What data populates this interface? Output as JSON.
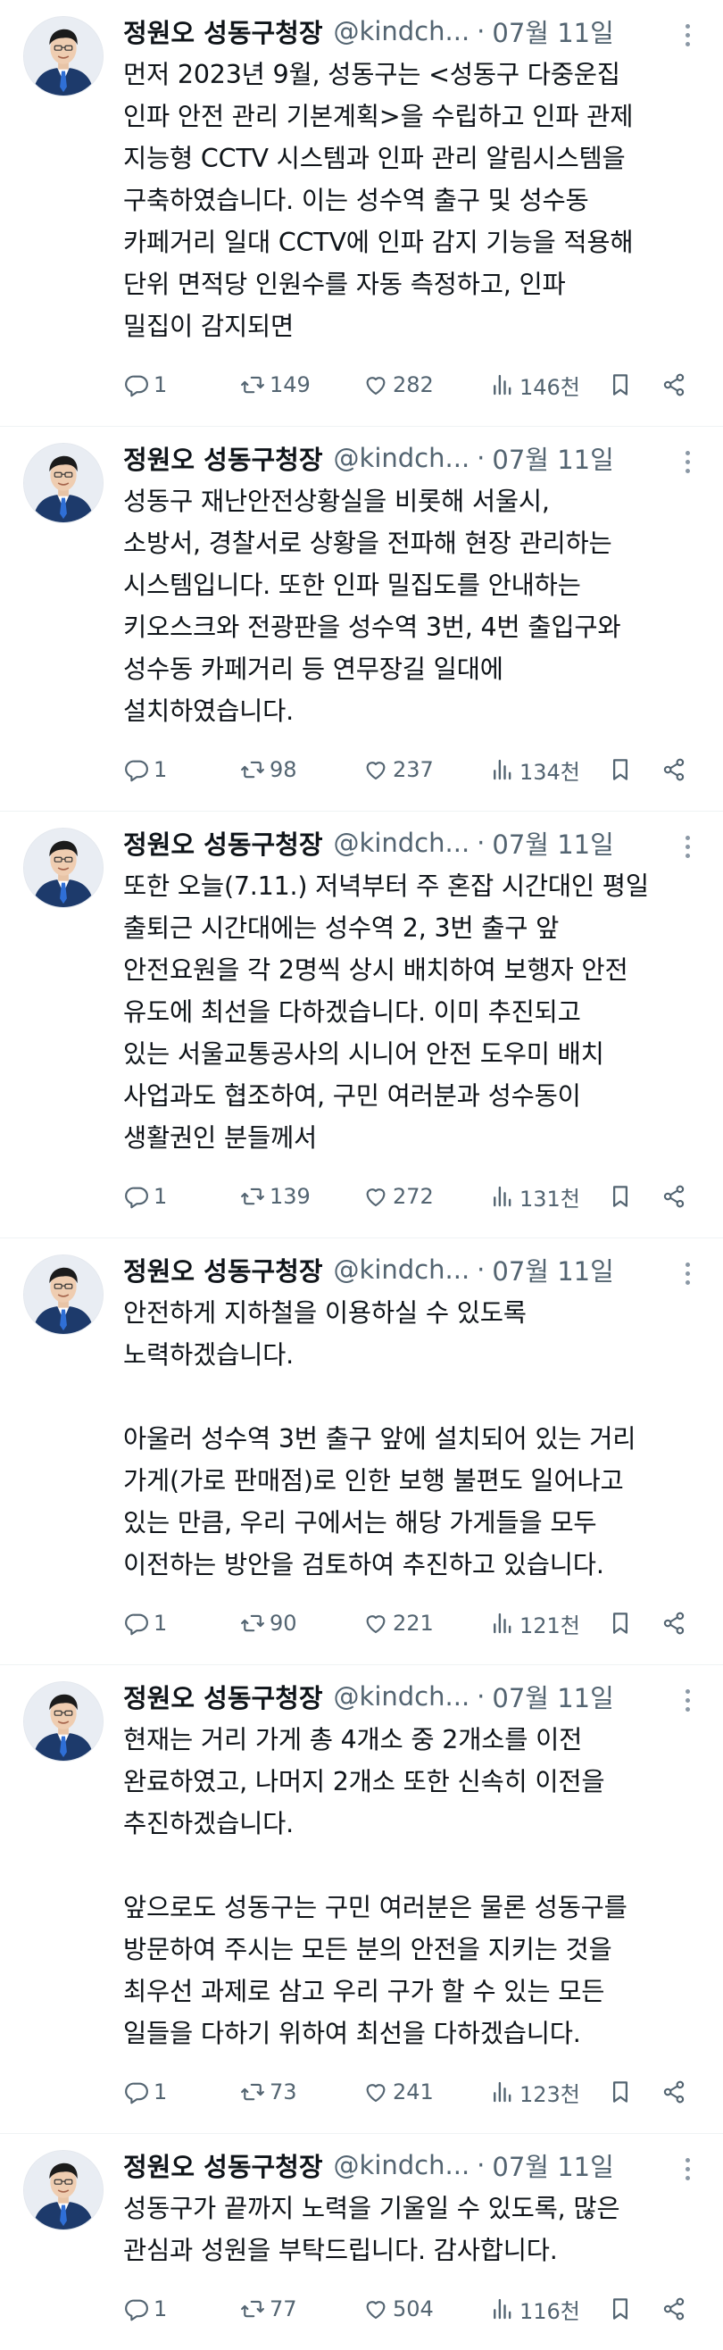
{
  "tweets": [
    {
      "name": "정원오 성동구청장",
      "handle": "@kindch...",
      "time": "07월 11일",
      "text": "먼저 2023년 9월, 성동구는 <성동구 다중운집\n인파 안전 관리 기본계획>을 수립하고 인파 관제\n지능형 CCTV 시스템과 인파 관리 알림시스템을\n구축하였습니다. 이는 성수역 출구 및 성수동\n카페거리 일대 CCTV에 인파 감지 기능을 적용해\n단위 면적당 인원수를 자동 측정하고, 인파\n밀집이 감지되면",
      "replies": "1",
      "retweets": "149",
      "likes": "282",
      "views": "146천"
    },
    {
      "name": "정원오 성동구청장",
      "handle": "@kindch...",
      "time": "07월 11일",
      "text": "성동구 재난안전상황실을 비롯해 서울시,\n소방서, 경찰서로 상황을 전파해 현장 관리하는\n시스템입니다. 또한 인파 밀집도를 안내하는\n키오스크와 전광판을 성수역 3번, 4번 출입구와\n성수동 카페거리 등 연무장길 일대에\n설치하였습니다.",
      "replies": "1",
      "retweets": "98",
      "likes": "237",
      "views": "134천"
    },
    {
      "name": "정원오 성동구청장",
      "handle": "@kindch...",
      "time": "07월 11일",
      "text": "또한 오늘(7.11.) 저녁부터 주 혼잡 시간대인 평일\n출퇴근 시간대에는 성수역 2, 3번 출구 앞\n안전요원을 각 2명씩 상시 배치하여 보행자 안전\n유도에 최선을 다하겠습니다. 이미 추진되고\n있는 서울교통공사의 시니어 안전 도우미 배치\n사업과도 협조하여, 구민 여러분과 성수동이\n생활권인 분들께서",
      "replies": "1",
      "retweets": "139",
      "likes": "272",
      "views": "131천"
    },
    {
      "name": "정원오 성동구청장",
      "handle": "@kindch...",
      "time": "07월 11일",
      "text": "안전하게 지하철을 이용하실 수 있도록\n노력하겠습니다.\n\n아울러 성수역 3번 출구 앞에 설치되어 있는 거리\n가게(가로 판매점)로 인한 보행 불편도 일어나고\n있는 만큼, 우리 구에서는 해당 가게들을 모두\n이전하는 방안을 검토하여 추진하고 있습니다.",
      "replies": "1",
      "retweets": "90",
      "likes": "221",
      "views": "121천"
    },
    {
      "name": "정원오 성동구청장",
      "handle": "@kindch...",
      "time": "07월 11일",
      "text": "현재는 거리 가게 총 4개소 중 2개소를 이전\n완료하였고, 나머지 2개소 또한 신속히 이전을\n추진하겠습니다.\n\n앞으로도 성동구는 구민 여러분은 물론 성동구를\n방문하여 주시는 모든 분의 안전을 지키는 것을\n최우선 과제로 삼고 우리 구가 할 수 있는 모든\n일들을 다하기 위하여 최선을 다하겠습니다.",
      "replies": "1",
      "retweets": "73",
      "likes": "241",
      "views": "123천"
    },
    {
      "name": "정원오 성동구청장",
      "handle": "@kindch...",
      "time": "07월 11일",
      "text": "성동구가 끝까지 노력을 기울일 수 있도록, 많은\n관심과 성원을 부탁드립니다. 감사합니다.",
      "replies": "1",
      "retweets": "77",
      "likes": "504",
      "views": "116천"
    }
  ],
  "separator": "·",
  "colors": {
    "text": "#0f1419",
    "secondary": "#536471",
    "divider": "#eff3f4",
    "suit": "#1d3a6b"
  },
  "icons": [
    "reply-icon",
    "retweet-icon",
    "like-icon",
    "views-icon",
    "bookmark-icon",
    "share-icon",
    "more-icon"
  ]
}
